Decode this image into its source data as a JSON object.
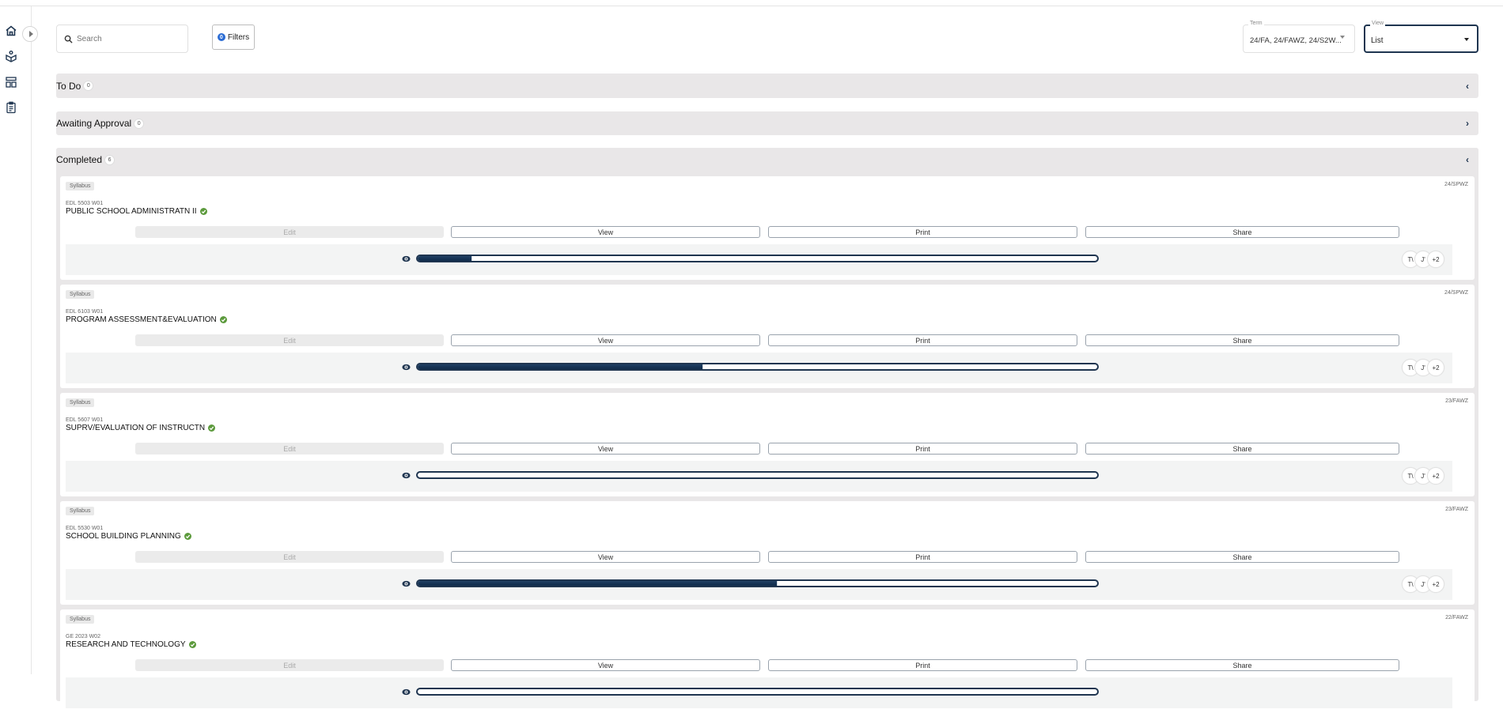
{
  "sidebar": {
    "items": [
      {
        "icon": "home-icon"
      },
      {
        "icon": "open-book-icon"
      },
      {
        "icon": "layout-icon"
      },
      {
        "icon": "clipboard-icon"
      }
    ],
    "expand_icon": "chevron-right-icon"
  },
  "toolbar": {
    "search_placeholder": "Search",
    "filters_label": "Filters",
    "filters_count": "0",
    "term": {
      "label": "Term",
      "value": "24/FA, 24/FAWZ, 24/S2W..."
    },
    "view": {
      "label": "View",
      "value": "List"
    }
  },
  "sections": [
    {
      "title": "To Do",
      "count": "0",
      "expanded": true
    },
    {
      "title": "Awaiting Approval",
      "count": "0",
      "expanded": false
    },
    {
      "title": "Completed",
      "count": "6",
      "expanded": true
    }
  ],
  "card_buttons": {
    "edit": "Edit",
    "view": "View",
    "print": "Print",
    "share": "Share"
  },
  "colors": {
    "accent": "#1f3550",
    "check": "#5c9a3c",
    "section_bg": "#e9e7e8"
  },
  "cards": [
    {
      "tag": "Syllabus",
      "term": "24/SPWZ",
      "code": "EDL 5503 W01",
      "name": "PUBLIC SCHOOL ADMINISTRATN II",
      "progress_percent": 8,
      "avatars": [
        "T\\",
        "J'",
        "+2"
      ]
    },
    {
      "tag": "Syllabus",
      "term": "24/SPWZ",
      "code": "EDL 6103 W01",
      "name": "PROGRAM ASSESSMENT&EVALUATION",
      "progress_percent": 42,
      "avatars": [
        "T\\",
        "J'",
        "+2"
      ]
    },
    {
      "tag": "Syllabus",
      "term": "23/FAWZ",
      "code": "EDL 5607 W01",
      "name": "SUPRV/EVALUATION OF INSTRUCTN",
      "progress_percent": 0,
      "avatars": [
        "T\\",
        "J'",
        "+2"
      ]
    },
    {
      "tag": "Syllabus",
      "term": "23/FAWZ",
      "code": "EDL 5530 W01",
      "name": "SCHOOL BUILDING PLANNING",
      "progress_percent": 53,
      "avatars": [
        "T\\",
        "J'",
        "+2"
      ]
    },
    {
      "tag": "Syllabus",
      "term": "22/FAWZ",
      "code": "GE 2023 W02",
      "name": "RESEARCH AND TECHNOLOGY",
      "progress_percent": null,
      "avatars": []
    }
  ]
}
